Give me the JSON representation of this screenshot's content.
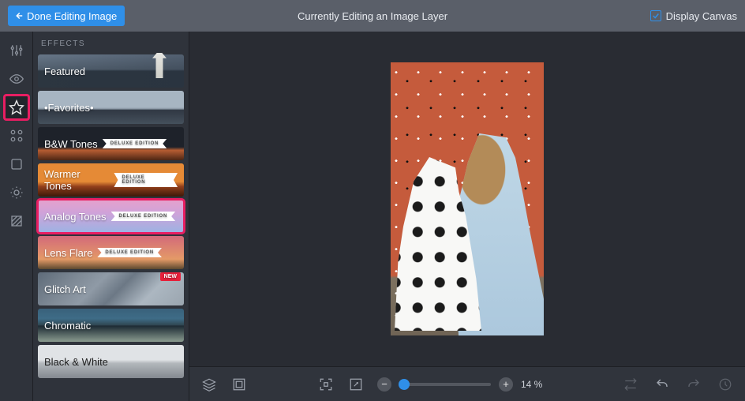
{
  "topbar": {
    "done_label": "Done Editing Image",
    "title": "Currently Editing an Image Layer",
    "display_canvas_label": "Display Canvas",
    "display_canvas_checked": true
  },
  "rail": {
    "items": [
      {
        "id": "adjustments",
        "name": "sliders-icon"
      },
      {
        "id": "visibility",
        "name": "eye-icon"
      },
      {
        "id": "effects",
        "name": "star-icon",
        "selected": true
      },
      {
        "id": "frames",
        "name": "sparkle-icon"
      },
      {
        "id": "crop",
        "name": "square-icon"
      },
      {
        "id": "shapes",
        "name": "hex-icon"
      },
      {
        "id": "textures",
        "name": "hatch-icon"
      }
    ]
  },
  "panel": {
    "header": "EFFECTS",
    "categories": [
      {
        "id": "featured",
        "label": "Featured",
        "bg": "bg-featured"
      },
      {
        "id": "favorites",
        "label": "•Favorites•",
        "bg": "bg-favorites"
      },
      {
        "id": "bw-tones",
        "label": "B&W Tones",
        "bg": "bg-bw",
        "deluxe": "DELUXE EDITION"
      },
      {
        "id": "warmer-tones",
        "label": "Warmer Tones",
        "bg": "bg-warm",
        "deluxe": "DELUXE EDITION"
      },
      {
        "id": "analog-tones",
        "label": "Analog Tones",
        "bg": "bg-analog",
        "deluxe": "DELUXE EDITION",
        "selected": true
      },
      {
        "id": "lens-flare",
        "label": "Lens Flare",
        "bg": "bg-lens",
        "deluxe": "DELUXE EDITION"
      },
      {
        "id": "glitch-art",
        "label": "Glitch Art",
        "bg": "bg-glitch",
        "new_badge": "NEW"
      },
      {
        "id": "chromatic",
        "label": "Chromatic",
        "bg": "bg-chromatic"
      },
      {
        "id": "black-white",
        "label": "Black & White",
        "bg": "bg-blackwhite"
      }
    ]
  },
  "bottombar": {
    "zoom_percent": "14 %",
    "zoom_value_linear": 0.05
  }
}
